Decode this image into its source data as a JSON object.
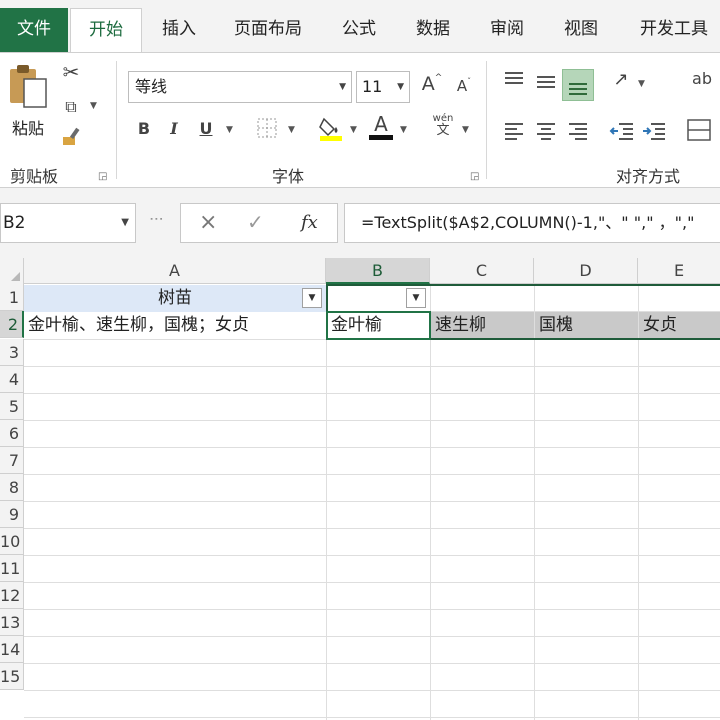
{
  "tabs": [
    "文件",
    "开始",
    "插入",
    "页面布局",
    "公式",
    "数据",
    "审阅",
    "视图",
    "开发工具"
  ],
  "ribbon": {
    "clipboard": {
      "paste_label": "粘贴",
      "group_label": "剪贴板"
    },
    "font": {
      "font_name": "等线",
      "font_size": "11",
      "grow_label": "A",
      "shrink_label": "A",
      "bold": "B",
      "italic": "I",
      "underline": "U",
      "font_color_label": "A",
      "phonetic_top": "wén",
      "phonetic_bottom": "文",
      "group_label": "字体"
    },
    "alignment": {
      "wrap_label": "ab",
      "group_label": "对齐方式"
    }
  },
  "formula_bar": {
    "name_box": "B2",
    "cancel_icon": "×",
    "enter_icon": "✓",
    "fx_label": "fx",
    "formula": "=TextSplit($A$2,COLUMN()-1,\"、\" \",\" ，\",\""
  },
  "grid": {
    "columns": [
      "A",
      "B",
      "C",
      "D",
      "E"
    ],
    "rows": [
      "1",
      "2",
      "3",
      "4",
      "5",
      "6",
      "7",
      "8",
      "9",
      "10",
      "11",
      "12",
      "13",
      "14",
      "15"
    ],
    "cells": {
      "A1": "树苗",
      "A2": "金叶榆、速生柳，国槐；女贞",
      "B2": "金叶榆",
      "C2": "速生柳",
      "D2": "国槐",
      "E2": "女贞"
    }
  },
  "colors": {
    "accent": "#217346",
    "header_fill": "#dde8f7",
    "spill_fill": "#c9c9c9"
  }
}
